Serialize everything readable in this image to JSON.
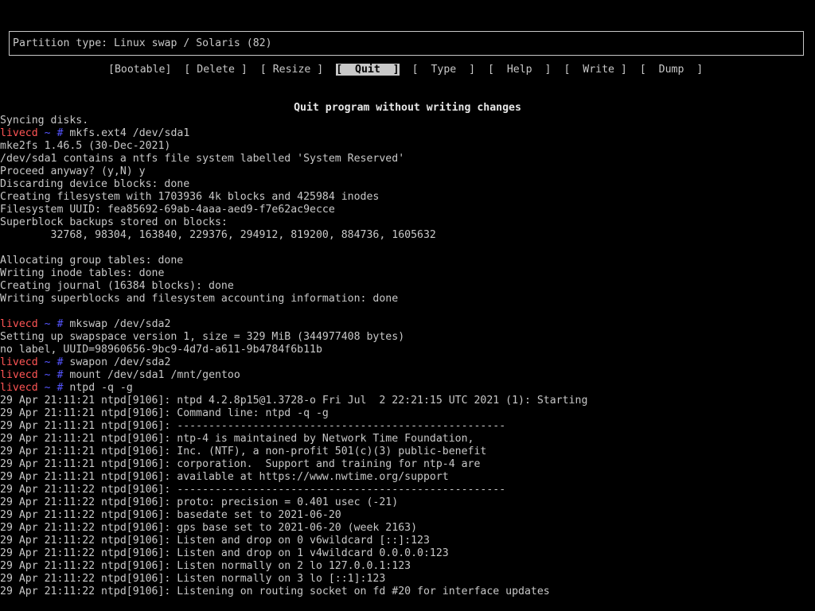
{
  "partition_box": {
    "text": "Partition type: Linux swap / Solaris (82)"
  },
  "menu": {
    "items": [
      {
        "label": "[Bootable]",
        "active": false
      },
      {
        "label": "[ Delete ]",
        "active": false
      },
      {
        "label": "[ Resize ]",
        "active": false
      },
      {
        "label": "[  Quit  ]",
        "active": true
      },
      {
        "label": "[  Type  ]",
        "active": false
      },
      {
        "label": "[  Help  ]",
        "active": false
      },
      {
        "label": "[  Write ]",
        "active": false
      },
      {
        "label": "[  Dump  ]",
        "active": false
      }
    ]
  },
  "hint": "Quit program without writing changes",
  "prompt": {
    "host": "livecd",
    "dir": "~",
    "symbol": "#"
  },
  "lines": [
    {
      "text": "Syncing disks."
    },
    {
      "cmd": "mkfs.ext4 /dev/sda1"
    },
    {
      "text": "mke2fs 1.46.5 (30-Dec-2021)"
    },
    {
      "text": "/dev/sda1 contains a ntfs file system labelled 'System Reserved'"
    },
    {
      "text": "Proceed anyway? (y,N) y"
    },
    {
      "text": "Discarding device blocks: done"
    },
    {
      "text": "Creating filesystem with 1703936 4k blocks and 425984 inodes"
    },
    {
      "text": "Filesystem UUID: fea85692-69ab-4aaa-aed9-f7e62ac9ecce"
    },
    {
      "text": "Superblock backups stored on blocks:"
    },
    {
      "text": "        32768, 98304, 163840, 229376, 294912, 819200, 884736, 1605632"
    },
    {
      "text": ""
    },
    {
      "text": "Allocating group tables: done"
    },
    {
      "text": "Writing inode tables: done"
    },
    {
      "text": "Creating journal (16384 blocks): done"
    },
    {
      "text": "Writing superblocks and filesystem accounting information: done"
    },
    {
      "text": ""
    },
    {
      "cmd": "mkswap /dev/sda2"
    },
    {
      "text": "Setting up swapspace version 1, size = 329 MiB (344977408 bytes)"
    },
    {
      "text": "no label, UUID=98960656-9bc9-4d7d-a611-9b4784f6b11b"
    },
    {
      "cmd": "swapon /dev/sda2"
    },
    {
      "cmd": "mount /dev/sda1 /mnt/gentoo"
    },
    {
      "cmd": "ntpd -q -g"
    },
    {
      "text": "29 Apr 21:11:21 ntpd[9106]: ntpd 4.2.8p15@1.3728-o Fri Jul  2 22:21:15 UTC 2021 (1): Starting"
    },
    {
      "text": "29 Apr 21:11:21 ntpd[9106]: Command line: ntpd -q -g"
    },
    {
      "text": "29 Apr 21:11:21 ntpd[9106]: ----------------------------------------------------"
    },
    {
      "text": "29 Apr 21:11:21 ntpd[9106]: ntp-4 is maintained by Network Time Foundation,"
    },
    {
      "text": "29 Apr 21:11:21 ntpd[9106]: Inc. (NTF), a non-profit 501(c)(3) public-benefit"
    },
    {
      "text": "29 Apr 21:11:21 ntpd[9106]: corporation.  Support and training for ntp-4 are"
    },
    {
      "text": "29 Apr 21:11:21 ntpd[9106]: available at https://www.nwtime.org/support"
    },
    {
      "text": "29 Apr 21:11:22 ntpd[9106]: ----------------------------------------------------"
    },
    {
      "text": "29 Apr 21:11:22 ntpd[9106]: proto: precision = 0.401 usec (-21)"
    },
    {
      "text": "29 Apr 21:11:22 ntpd[9106]: basedate set to 2021-06-20"
    },
    {
      "text": "29 Apr 21:11:22 ntpd[9106]: gps base set to 2021-06-20 (week 2163)"
    },
    {
      "text": "29 Apr 21:11:22 ntpd[9106]: Listen and drop on 0 v6wildcard [::]:123"
    },
    {
      "text": "29 Apr 21:11:22 ntpd[9106]: Listen and drop on 1 v4wildcard 0.0.0.0:123"
    },
    {
      "text": "29 Apr 21:11:22 ntpd[9106]: Listen normally on 2 lo 127.0.0.1:123"
    },
    {
      "text": "29 Apr 21:11:22 ntpd[9106]: Listen normally on 3 lo [::1]:123"
    },
    {
      "text": "29 Apr 21:11:22 ntpd[9106]: Listening on routing socket on fd #20 for interface updates"
    }
  ]
}
